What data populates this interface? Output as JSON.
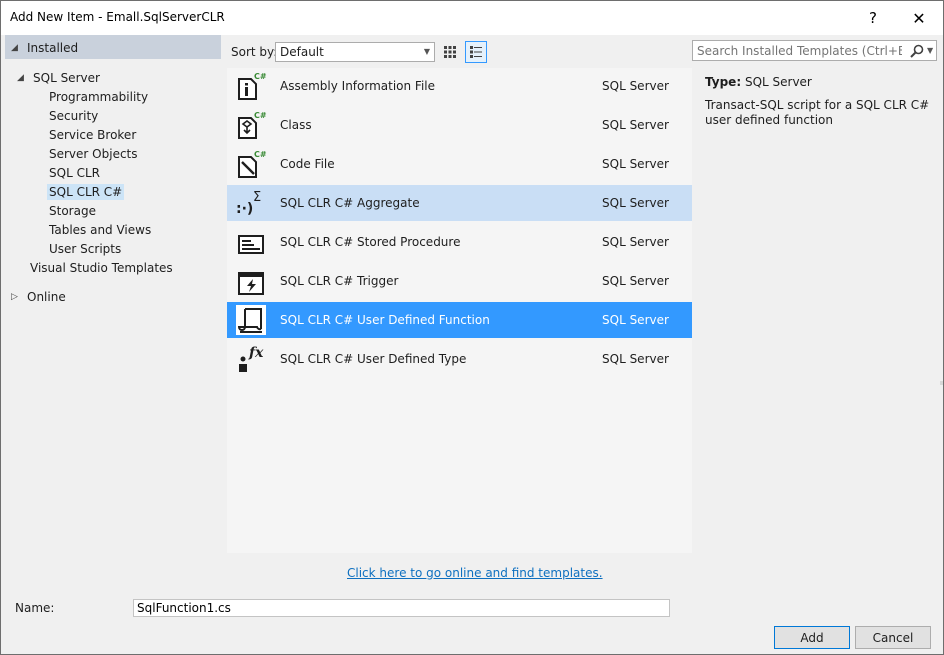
{
  "window": {
    "title": "Add New Item - Emall.SqlServerCLR",
    "help_glyph": "?",
    "close_glyph": "✕"
  },
  "tree": {
    "installed": "Installed",
    "sql_server": "SQL Server",
    "children": [
      "Programmability",
      "Security",
      "Service Broker",
      "Server Objects",
      "SQL CLR",
      "SQL CLR C#",
      "Storage",
      "Tables and Views",
      "User Scripts"
    ],
    "vs_templates": "Visual Studio Templates",
    "online": "Online"
  },
  "toolbar": {
    "sort_label": "Sort by:",
    "sort_value": "Default"
  },
  "templates": [
    {
      "name": "Assembly Information File",
      "category": "SQL Server",
      "icon": "assembly-info-file-icon"
    },
    {
      "name": "Class",
      "category": "SQL Server",
      "icon": "class-file-icon"
    },
    {
      "name": "Code File",
      "category": "SQL Server",
      "icon": "code-file-icon"
    },
    {
      "name": "SQL CLR C# Aggregate",
      "category": "SQL Server",
      "icon": "aggregate-icon"
    },
    {
      "name": "SQL CLR C# Stored Procedure",
      "category": "SQL Server",
      "icon": "stored-procedure-icon"
    },
    {
      "name": "SQL CLR C# Trigger",
      "category": "SQL Server",
      "icon": "trigger-icon"
    },
    {
      "name": "SQL CLR C# User Defined Function",
      "category": "SQL Server",
      "icon": "user-defined-function-icon"
    },
    {
      "name": "SQL CLR C# User Defined Type",
      "category": "SQL Server",
      "icon": "user-defined-type-icon"
    }
  ],
  "online_link": "Click here to go online and find templates.",
  "search": {
    "placeholder": "Search Installed Templates (Ctrl+E)"
  },
  "details": {
    "type_label": "Type:",
    "type_value": "SQL Server",
    "description": "Transact-SQL script for a SQL CLR C# user defined function"
  },
  "name_field": {
    "label": "Name:",
    "value": "SqlFunction1.cs"
  },
  "buttons": {
    "add": "Add",
    "cancel": "Cancel"
  },
  "colors": {
    "selection": "#3399ff",
    "hover": "#c9def5",
    "link": "#0e70c0",
    "tree_header": "#c9d1dc"
  }
}
